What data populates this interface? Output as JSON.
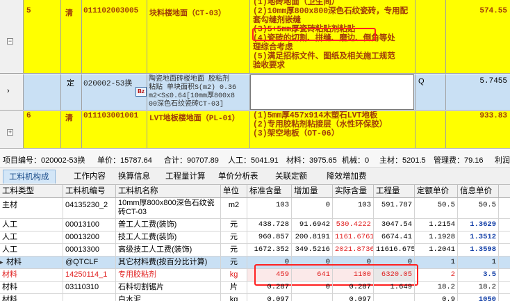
{
  "top_rows": [
    {
      "num": "5",
      "type": "清",
      "code": "011102003005",
      "name": "块料楼地面（CT-03）",
      "desc_lines": [
        "(1)地砖地面（卫生间）",
        "(2)10mm厚800x800深色石纹瓷砖，专用配",
        "套勾缝剂嵌缝",
        "(3)5+5mm厚瓷砖粘贴剂粘贴",
        "(4)瓷砖的切割、拼缝、磨边、倒角等处",
        "理综合考虑",
        "(5)满足招标文件、图纸及相关施工规范",
        "验收要求"
      ],
      "amount": "574.55",
      "expander": "−"
    },
    {
      "type": "定",
      "code": "020002-53换",
      "name_lines": [
        "陶瓷地面砖楼地面 胶粘剂",
        "粘贴 单块面积S(m2) 0.36",
        "m2<S≤0.64[10mm厚800x8",
        "00深色石纹瓷砖CT-03]"
      ],
      "unit": "Q",
      "amount": "5.7455",
      "icon": "Bz"
    },
    {
      "num": "6",
      "type": "清",
      "code": "011103001001",
      "name": "LVT地板楼地面（PL-01）",
      "desc_lines": [
        "(1)5mm厚457x914木塑石LVT地板",
        "(2)专用胶粘剂粘接层（水性环保胶）",
        "(3)架空地板（OT-06）"
      ],
      "amount": "933.83",
      "expander": "+"
    }
  ],
  "info": {
    "item_no": "项目编号：020002-53换",
    "unit_price": "单价：15787.64",
    "total": "合计：90707.89",
    "labor": "人工：5041.91",
    "material": "材料：3975.65",
    "machine": "机械：0",
    "main_material": "主材：5201.5",
    "mgmt_fee": "管理费：79.16",
    "profit": "利润"
  },
  "tabs": [
    "工料机构成",
    "工作内容",
    "换算信息",
    "工程量计算",
    "单价分析表",
    "关联定额",
    "降效增加费"
  ],
  "table": {
    "headers": [
      "工料类型",
      "工料机编号",
      "工料机名称",
      "单位",
      "标准含量",
      "增加量",
      "实际含量",
      "工程量",
      "定额单价",
      "信息单价",
      ""
    ],
    "rows": [
      [
        "主材",
        "04135230_2",
        "10mm厚800x800深色石纹瓷砖CT-03",
        "m2",
        "103",
        "0",
        "103",
        "591.787",
        "50.5",
        "50.5"
      ],
      [
        "人工",
        "00013100",
        "普工人工费(装饰)",
        "元",
        "438.728",
        "91.6942",
        "530.4222",
        "3047.54",
        "1.2154",
        "1.3629"
      ],
      [
        "人工",
        "00013200",
        "技工人工费(装饰)",
        "元",
        "960.857",
        "200.8191",
        "1161.6761",
        "6674.41",
        "1.1928",
        "1.3512"
      ],
      [
        "人工",
        "00013300",
        "高级技工人工费(装饰)",
        "元",
        "1672.352",
        "349.5216",
        "2021.8736",
        "11616.675",
        "1.2041",
        "1.3598"
      ],
      [
        "材料",
        "@QTCLF",
        "其它材料费(按百分比计算)",
        "元",
        "0",
        "0",
        "0",
        "0",
        "1",
        "1"
      ],
      [
        "材料",
        "14250114_1",
        "专用胶粘剂",
        "kg",
        "459",
        "641",
        "1100",
        "6320.05",
        "2",
        "3.5"
      ],
      [
        "材料",
        "03110310",
        "石料切割锯片",
        "片",
        "0.287",
        "0",
        "0.287",
        "1.649",
        "18.2",
        "18.2"
      ],
      [
        "材料",
        "",
        "白水泥",
        "kg",
        "0.097",
        "",
        "0.097",
        "",
        "0.9",
        "1050"
      ]
    ],
    "row_marker": "▸"
  },
  "colors": {
    "yellow": "#ffff00",
    "blue": "#c9e0f4",
    "red": "#e01e1e",
    "brown": "#a03c0a",
    "info_blue": "#1440a8"
  }
}
